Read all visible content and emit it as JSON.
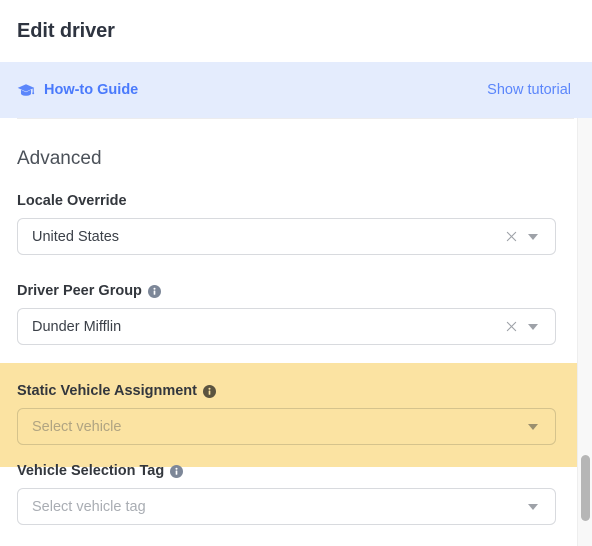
{
  "header": {
    "title": "Edit driver"
  },
  "guide_banner": {
    "icon": "graduation-cap-icon",
    "label": "How-to Guide",
    "action_label": "Show tutorial",
    "background_color": "#e4ecfd",
    "text_color": "#4a7afc"
  },
  "section": {
    "title": "Advanced"
  },
  "fields": [
    {
      "label": "Locale Override",
      "has_info_icon": false,
      "value": "United States",
      "placeholder": "",
      "clearable": true,
      "highlighted": false
    },
    {
      "label": "Driver Peer Group",
      "has_info_icon": true,
      "value": "Dunder Mifflin",
      "placeholder": "",
      "clearable": true,
      "highlighted": false
    },
    {
      "label": "Static Vehicle Assignment",
      "has_info_icon": true,
      "value": "",
      "placeholder": "Select vehicle",
      "clearable": false,
      "highlighted": true
    },
    {
      "label": "Vehicle Selection Tag",
      "has_info_icon": true,
      "value": "",
      "placeholder": "Select vehicle tag",
      "clearable": false,
      "highlighted": false
    }
  ],
  "highlight": {
    "color": "#fbe3a2"
  },
  "scrollbar": {
    "orientation": "vertical",
    "thumb_color": "#b6b6b6"
  }
}
